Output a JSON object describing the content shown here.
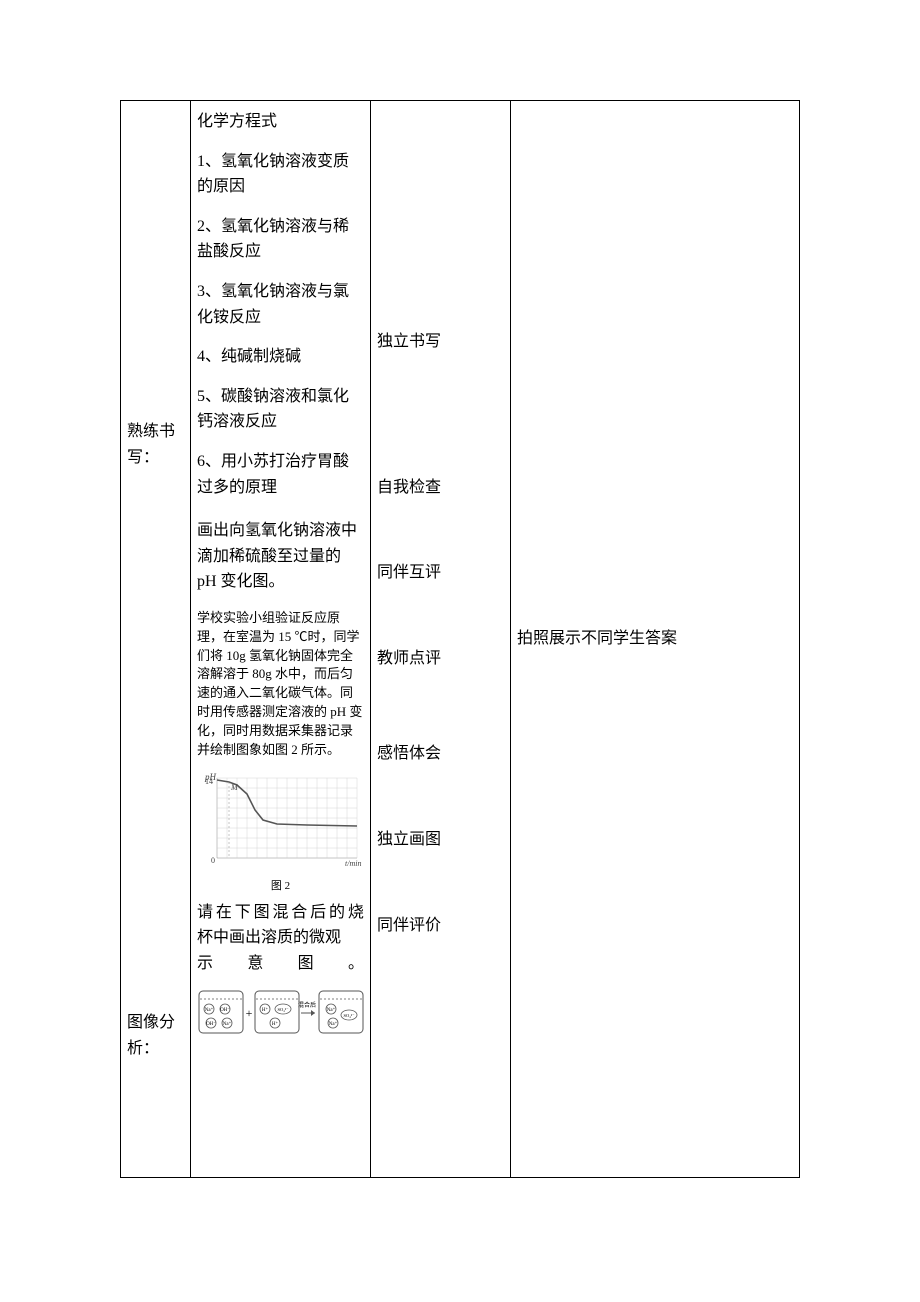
{
  "row": {
    "col1_labels": {
      "label_a": "熟练书写：",
      "label_b": "图像分析："
    },
    "col2": {
      "section_title": "化学方程式",
      "items": [
        "1、氢氧化钠溶液变质的原因",
        "2、氢氧化钠溶液与稀盐酸反应",
        "3、氢氧化钠溶液与氯化铵反应",
        "4、纯碱制烧碱",
        "5、碳酸钠溶液和氯化钙溶液反应",
        "6、用小苏打治疗胃酸过多的原理"
      ],
      "ph_para": "画出向氢氧化钠溶液中滴加稀硫酸至过量的 pH 变化图。",
      "exp_small": "学校实验小组验证反应原理，在室温为 15 ℃时，同学们将 10g 氢氧化钠固体完全溶解溶于 80g 水中，而后匀速的通入二氧化碳气体。同时用传感器测定溶液的 pH 变化，同时用数据采集器记录并绘制图象如图 2 所示。",
      "chart_caption": "图 2",
      "after_chart_l1_chars": [
        "请",
        "在",
        "下",
        "图",
        "混",
        "合",
        "后",
        "的",
        "烧"
      ],
      "after_chart_l2": "杯中画出溶质的微观",
      "after_chart_l3_chars": [
        "示",
        "意",
        "图",
        "。"
      ],
      "beaker_arrow": "混合后",
      "labels": {
        "na": "Na⁺",
        "oh": "OH⁻",
        "h": "H⁺",
        "so4": "SO₄²⁻"
      }
    },
    "col3": {
      "items": [
        "独立书写",
        "自我检查",
        "同伴互评",
        "教师点评",
        "感悟体会",
        "独立画图",
        "同伴评价"
      ]
    },
    "col4": {
      "text": "拍照展示不同学生答案"
    }
  },
  "chart_data": {
    "type": "line",
    "xlabel": "t/min",
    "ylabel": "pH",
    "ylim": [
      0,
      14
    ],
    "xlim": [
      0,
      100
    ],
    "series": [
      {
        "name": "pH",
        "x": [
          0,
          5,
          10,
          20,
          30,
          40,
          60,
          80,
          100
        ],
        "y": [
          14,
          13.8,
          13.5,
          12,
          9,
          8.2,
          8,
          7.9,
          7.8
        ]
      }
    ],
    "annotations": [
      {
        "label": "M",
        "x": 8,
        "y": 13.5
      }
    ]
  }
}
